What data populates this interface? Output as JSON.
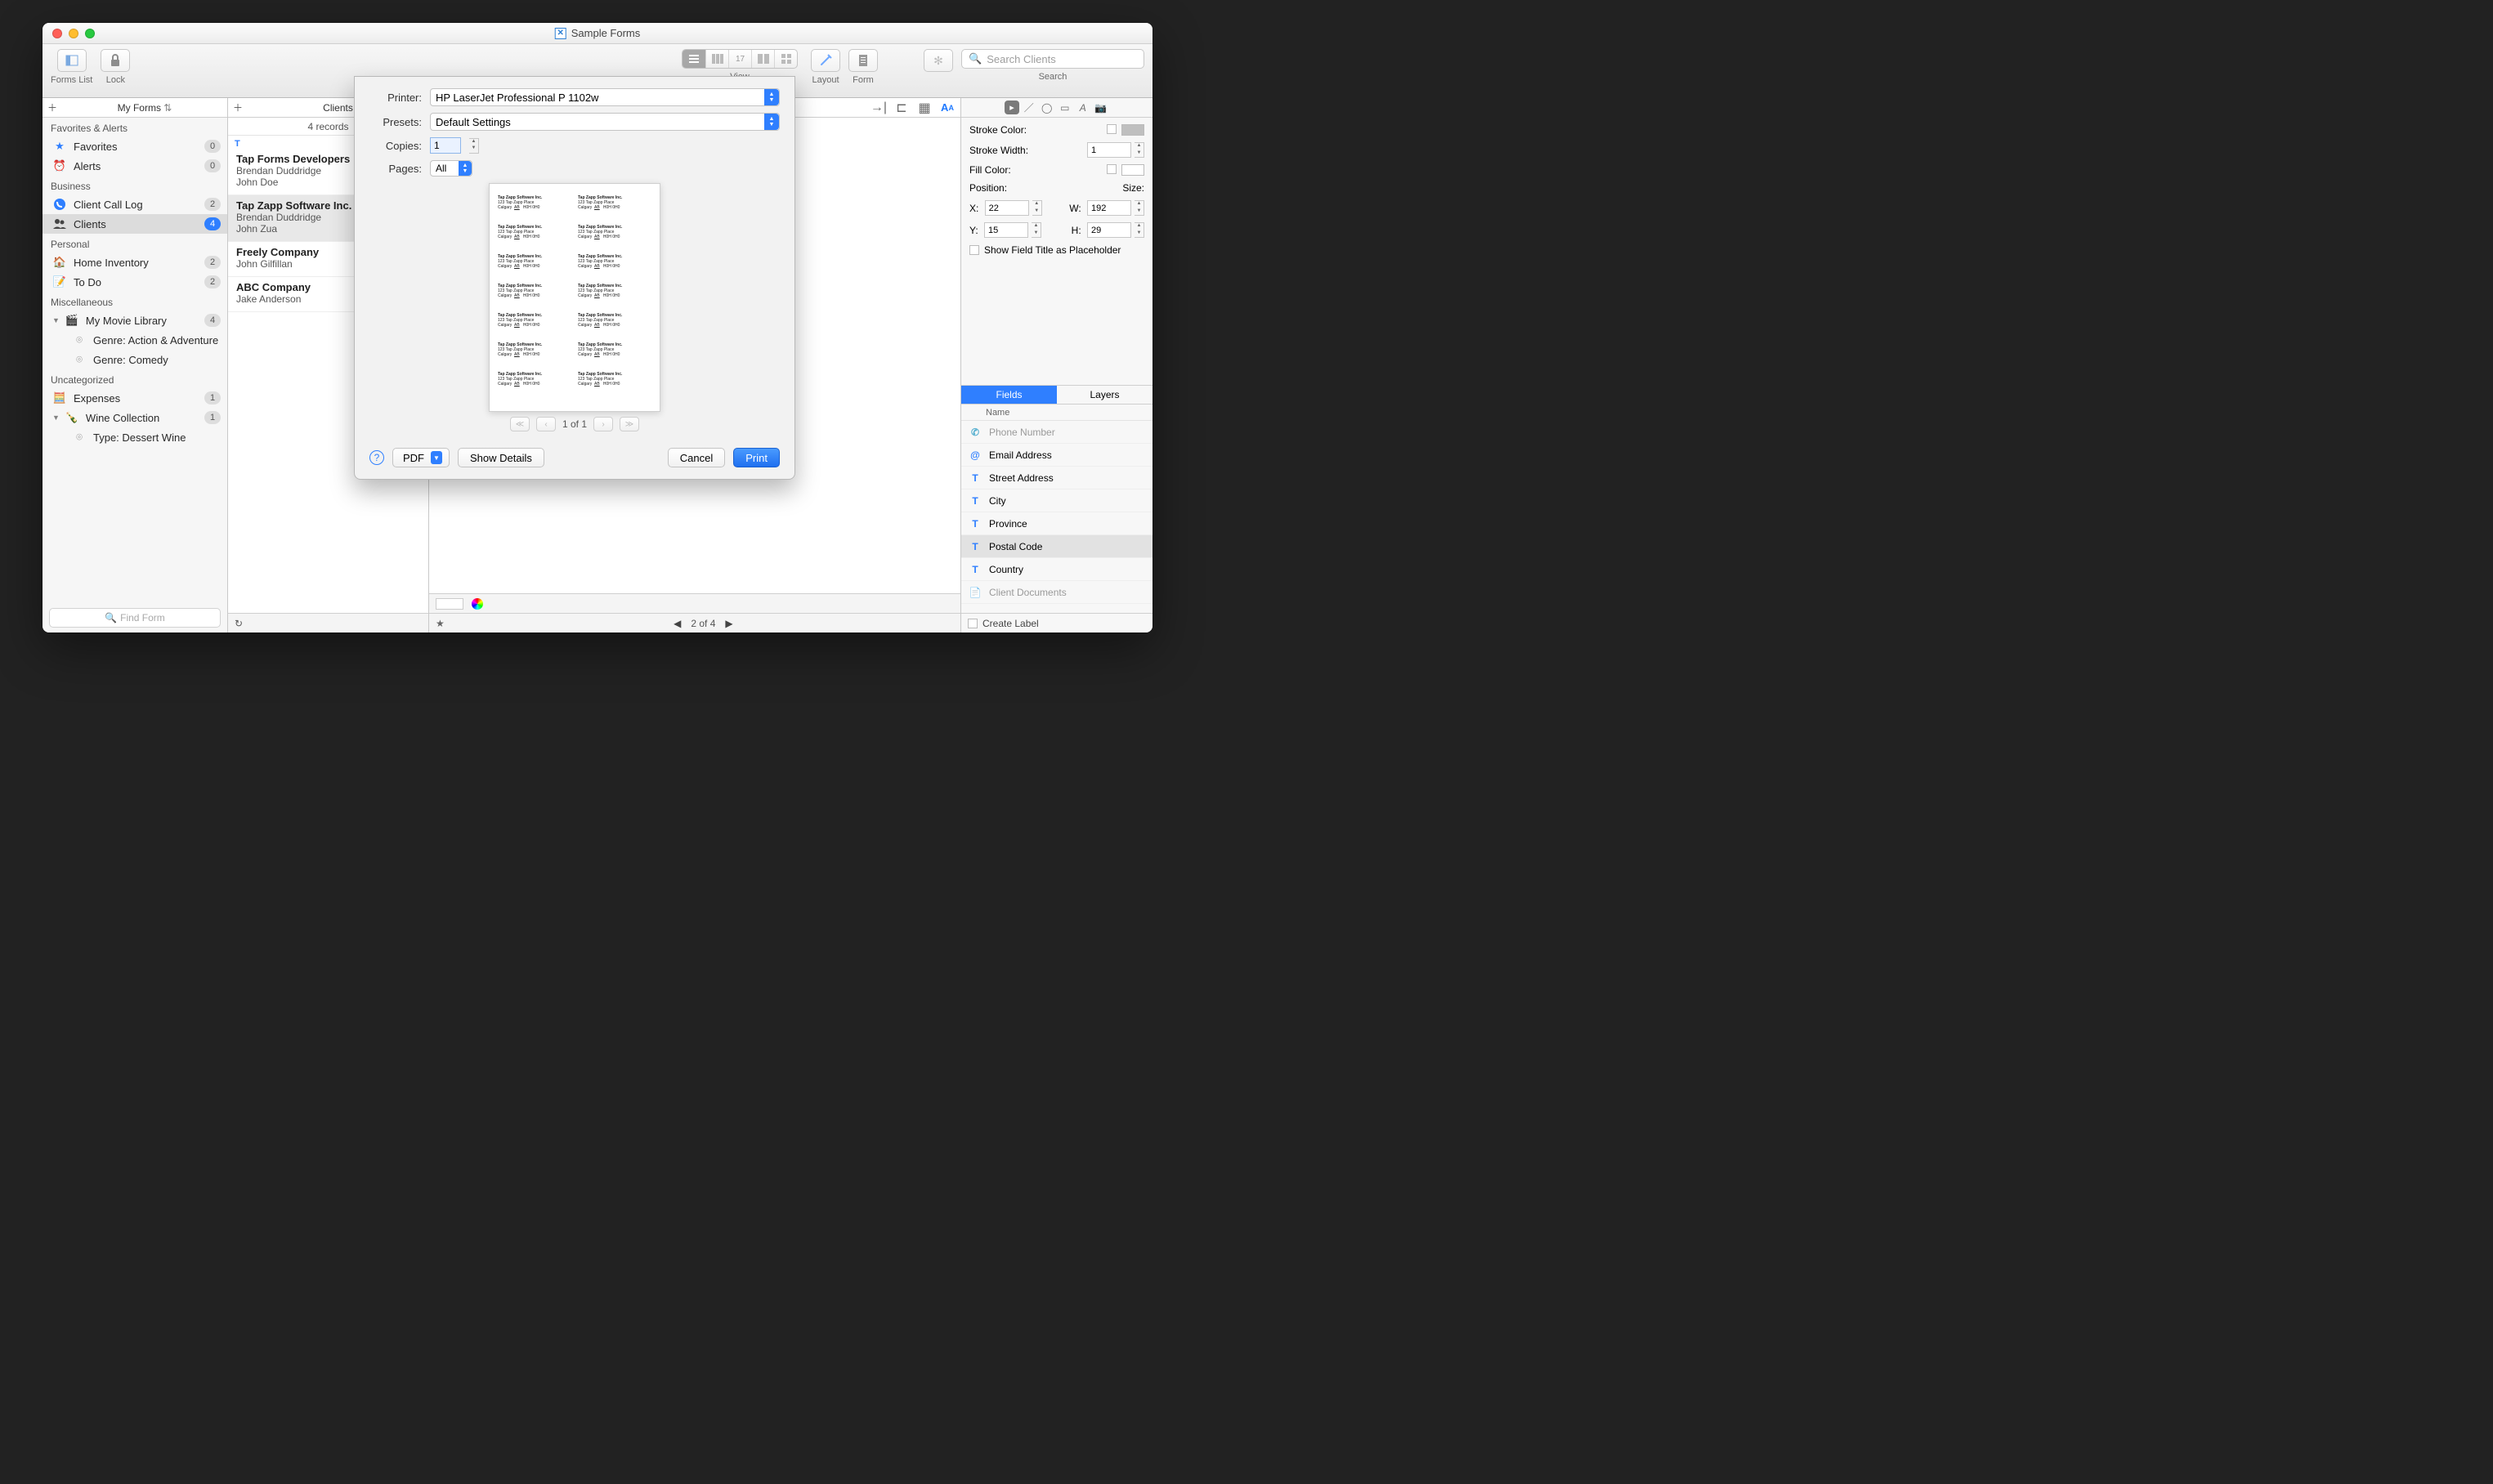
{
  "window": {
    "title": "Sample Forms"
  },
  "toolbar": {
    "formsList": "Forms List",
    "lock": "Lock",
    "view": "View",
    "layout": "Layout",
    "form": "Form",
    "search": "Search",
    "searchPlaceholder": "Search Clients"
  },
  "sidebar": {
    "header": "My Forms",
    "sections": {
      "favorites": "Favorites & Alerts",
      "business": "Business",
      "personal": "Personal",
      "misc": "Miscellaneous",
      "uncat": "Uncategorized"
    },
    "items": {
      "favorites": {
        "label": "Favorites",
        "count": "0"
      },
      "alerts": {
        "label": "Alerts",
        "count": "0"
      },
      "callLog": {
        "label": "Client Call Log",
        "count": "2"
      },
      "clients": {
        "label": "Clients",
        "count": "4"
      },
      "homeInv": {
        "label": "Home Inventory",
        "count": "2"
      },
      "todo": {
        "label": "To Do",
        "count": "2"
      },
      "movieLib": {
        "label": "My Movie Library",
        "count": "4"
      },
      "genreAction": {
        "label": "Genre: Action & Adventure"
      },
      "genreComedy": {
        "label": "Genre: Comedy"
      },
      "expenses": {
        "label": "Expenses",
        "count": "1"
      },
      "wine": {
        "label": "Wine Collection",
        "count": "1"
      },
      "wineType": {
        "label": "Type: Dessert Wine"
      }
    },
    "findPlaceholder": "Find Form"
  },
  "clients": {
    "header": "Clients",
    "count": "4 records",
    "letter": "T",
    "items": [
      {
        "name": "Tap Forms Developers",
        "subs": [
          "Brendan Duddridge",
          "John Doe"
        ]
      },
      {
        "name": "Tap Zapp Software Inc.",
        "subs": [
          "Brendan Duddridge",
          "John Zua"
        ]
      },
      {
        "name": "Freely Company",
        "subs": [
          "John Gilfillan"
        ]
      },
      {
        "name": "ABC Company",
        "subs": [
          "Jake Anderson"
        ]
      }
    ]
  },
  "footer": {
    "pager": "2 of 4"
  },
  "inspector": {
    "strokeColorLabel": "Stroke Color:",
    "strokeWidthLabel": "Stroke Width:",
    "strokeWidthValue": "1",
    "fillColorLabel": "Fill Color:",
    "positionLabel": "Position:",
    "sizeLabel": "Size:",
    "x": "22",
    "y": "15",
    "w": "192",
    "h": "29",
    "placeholderLabel": "Show Field Title as Placeholder",
    "tabs": {
      "fields": "Fields",
      "layers": "Layers"
    },
    "fieldsHeader": "Name",
    "fields": [
      {
        "icon": "ph",
        "label": "Phone Number"
      },
      {
        "icon": "at",
        "label": "Email Address"
      },
      {
        "icon": "T",
        "label": "Street Address"
      },
      {
        "icon": "T",
        "label": "City"
      },
      {
        "icon": "T",
        "label": "Province"
      },
      {
        "icon": "T",
        "label": "Postal Code"
      },
      {
        "icon": "T",
        "label": "Country"
      },
      {
        "icon": "doc",
        "label": "Client Documents"
      }
    ],
    "createLabel": "Create Label"
  },
  "print": {
    "printerLabel": "Printer:",
    "printerValue": "HP LaserJet Professional P 1102w",
    "presetsLabel": "Presets:",
    "presetsValue": "Default Settings",
    "copiesLabel": "Copies:",
    "copiesValue": "1",
    "pagesLabel": "Pages:",
    "pagesValue": "All",
    "pageNav": "1 of 1",
    "pdf": "PDF",
    "showDetails": "Show Details",
    "cancel": "Cancel",
    "print": "Print",
    "address": {
      "l1": "Tap Zapp Software Inc.",
      "l2": "123 Tap Zapp Place",
      "l3a": "Calgary",
      "l3b": "AB",
      "l3c": "H0H 0H0"
    }
  }
}
